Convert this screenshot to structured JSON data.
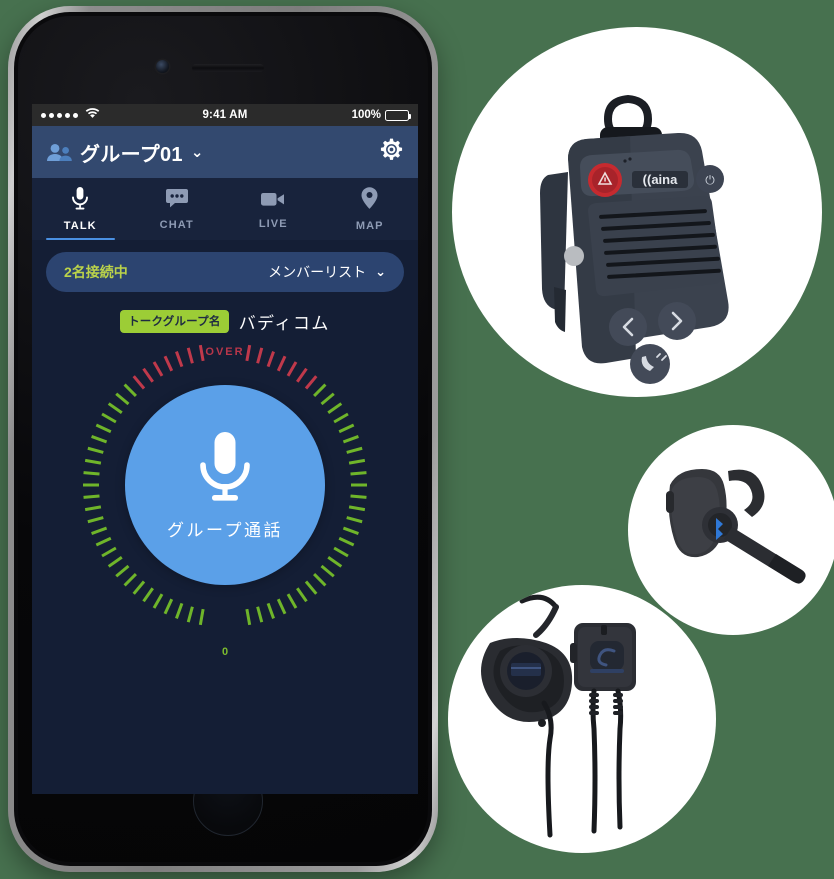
{
  "status_bar": {
    "signal_dots": 5,
    "wifi_icon": "wifi-icon",
    "time": "9:41 AM",
    "battery_percent": "100%",
    "battery_level": 100
  },
  "header": {
    "group_icon": "group-people-icon",
    "group_title": "グループ01",
    "caret": "⌄",
    "settings_icon": "gear-icon",
    "background_color": "#33496F"
  },
  "tabs": [
    {
      "id": "talk",
      "label": "TALK",
      "icon": "microphone-icon",
      "active": true
    },
    {
      "id": "chat",
      "label": "CHAT",
      "icon": "chat-bubble-icon",
      "active": false
    },
    {
      "id": "live",
      "label": "LIVE",
      "icon": "video-camera-icon",
      "active": false
    },
    {
      "id": "map",
      "label": "MAP",
      "icon": "location-pin-icon",
      "active": false
    }
  ],
  "member_bar": {
    "connected_text": "2名接続中",
    "connected_color": "#BBD34A",
    "member_list_label": "メンバーリスト",
    "caret": "⌄",
    "background_color": "#2C4470"
  },
  "talk_group": {
    "badge_label": "トークグループ名",
    "badge_color": "#9CCD36",
    "name": "バディコム"
  },
  "ptt": {
    "icon": "microphone-icon",
    "label": "グループ通話",
    "circle_color": "#5BA0E8"
  },
  "gauge": {
    "over_label": "OVER",
    "over_color": "#B8364A",
    "zero_label": "0",
    "zero_color": "#7CBB2E",
    "green_color": "#6FB52A",
    "red_color": "#C0394B",
    "total_ticks": 72
  },
  "products": [
    {
      "id": "radio",
      "name": "speaker-microphone-device",
      "brand_text": "aina",
      "emergency_button_color": "#C62A2F"
    },
    {
      "id": "headset",
      "name": "bluetooth-ear-hook-headset"
    },
    {
      "id": "earpiece",
      "name": "earpiece-with-ptt-button"
    }
  ],
  "theme": {
    "page_background": "#47714F",
    "app_background": "#141E35",
    "tabs_background": "#18233C",
    "accent_blue": "#4A90E2"
  }
}
